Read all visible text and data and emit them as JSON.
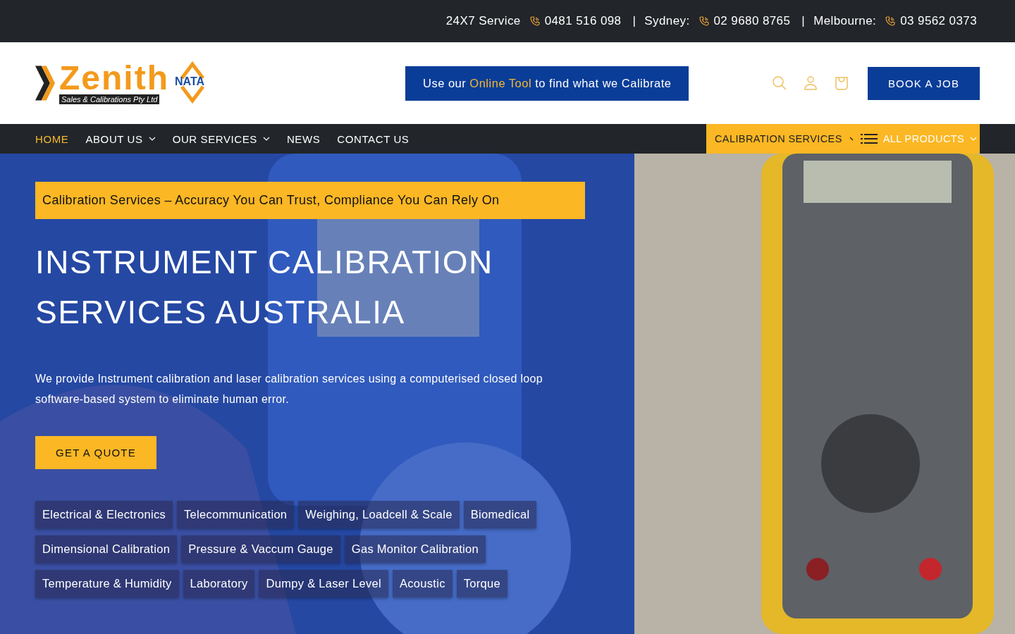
{
  "top_bar": {
    "service_label": "24X7 Service",
    "contacts": [
      {
        "number": "0481 516 098"
      },
      {
        "label": "Sydney:",
        "number": "02 9680 8765"
      },
      {
        "label": "Melbourne:",
        "number": "03 9562 0373"
      }
    ],
    "separator": "|"
  },
  "logo": {
    "name": "Zenith",
    "tagline": "Sales & Calibrations Pty Ltd",
    "badge": "NATA"
  },
  "online_tool": {
    "before": "Use our",
    "link": "Online Tool",
    "after": "to find what we Calibrate"
  },
  "book_button": "BOOK A JOB",
  "nav": [
    {
      "label": "HOME",
      "selected": true,
      "dropdown": false
    },
    {
      "label": "ABOUT US",
      "selected": false,
      "dropdown": true
    },
    {
      "label": "OUR SERVICES",
      "selected": false,
      "dropdown": true
    },
    {
      "label": "NEWS",
      "selected": false,
      "dropdown": false
    },
    {
      "label": "CONTACT US",
      "selected": false,
      "dropdown": false
    }
  ],
  "nav_right": {
    "calibration": "CALIBRATION SERVICES",
    "products": "ALL PRODUCTS"
  },
  "hero": {
    "kind": "picture",
    "banner": "Calibration Services – Accuracy You Can Trust, Compliance You Can Rely On",
    "title": "INSTRUMENT CALIBRATION SERVICES AUSTRALIA",
    "description": "We provide Instrument calibration and laser calibration services using a computerised closed loop software-based system to eliminate human error.",
    "cta": "GET A QUOTE",
    "tag_rows": [
      [
        "Electrical & Electronics",
        "Telecommunication",
        "Weighing, Loadcell & Scale",
        "Biomedical"
      ],
      [
        "Dimensional Calibration",
        "Pressure & Vaccum Gauge",
        "Gas Monitor Calibration"
      ],
      [
        "Temperature & Humidity",
        "Laboratory",
        "Dumpy & Laser Level",
        "Acoustic",
        "Torque"
      ]
    ]
  }
}
